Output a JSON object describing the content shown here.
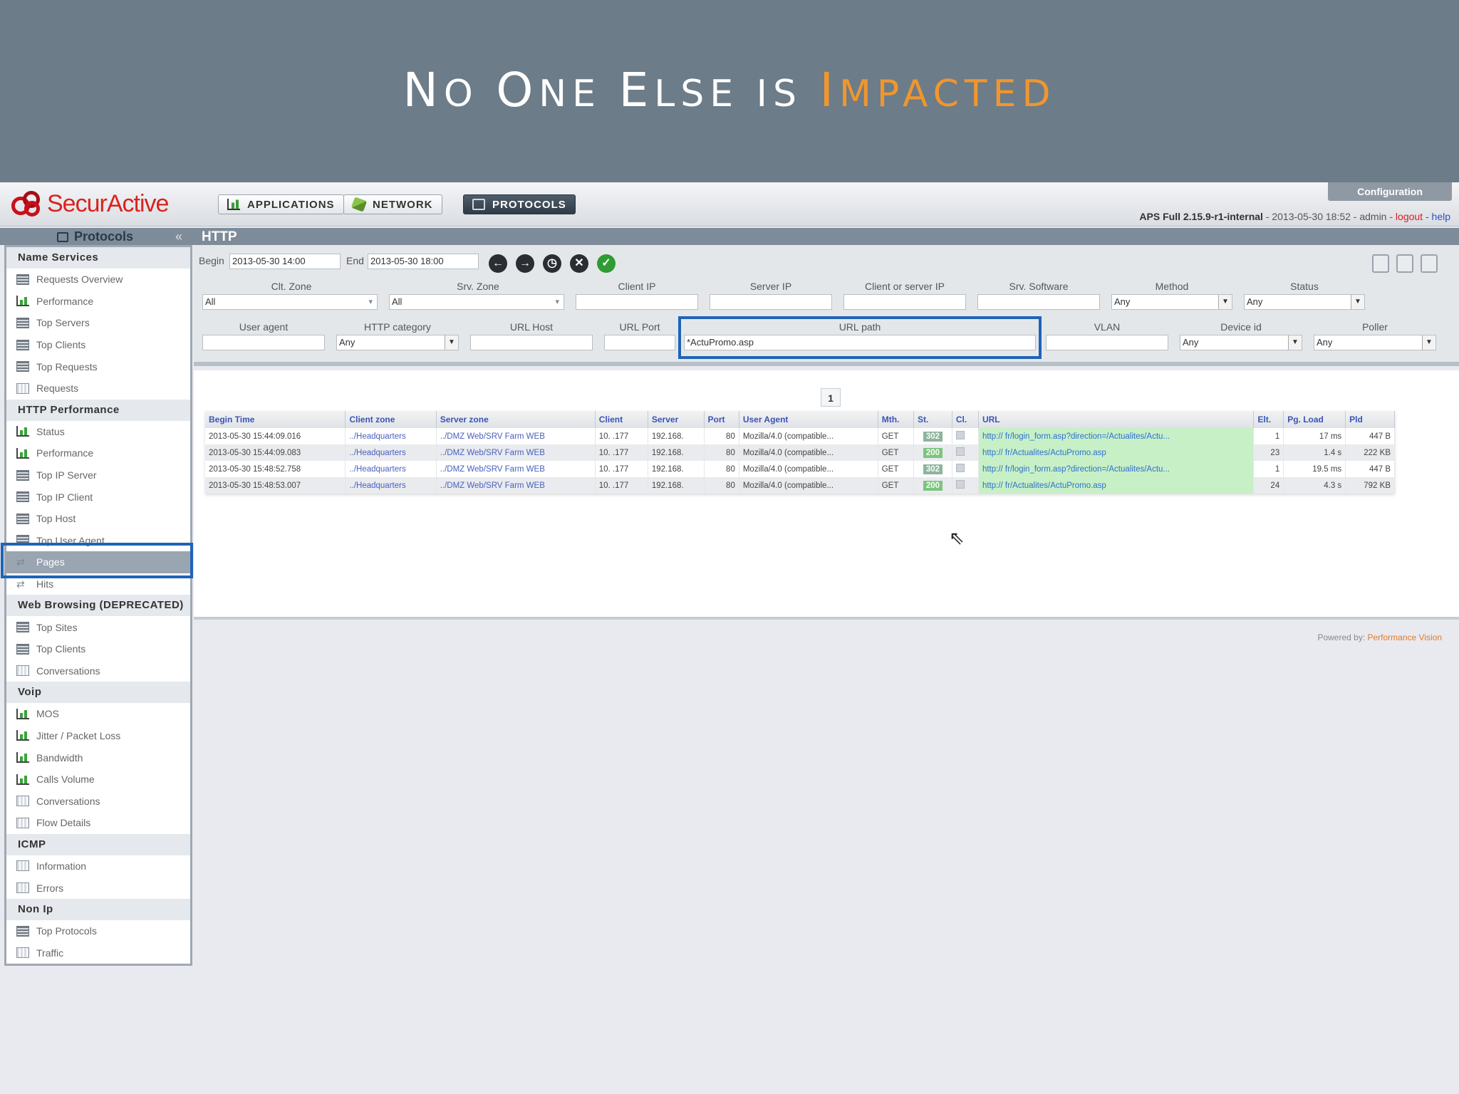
{
  "slide": {
    "title_part1_initial": "N",
    "title_part1_rest": "O ",
    "title_part2_initial": "O",
    "title_part2_rest": "NE ",
    "title_part3_initial": "E",
    "title_part3_rest": "LSE ",
    "title_part4": "IS ",
    "title_hl_initial": "I",
    "title_hl_rest": "MPACTED",
    "title_accent_color": "#f0962e"
  },
  "app": {
    "brand": "SecurActive",
    "tabs": [
      {
        "label": "APPLICATIONS",
        "icon": "chart-icon"
      },
      {
        "label": "NETWORK",
        "icon": "network-icon"
      },
      {
        "label": "PROTOCOLS",
        "icon": "protocols-icon"
      }
    ],
    "config_label": "Configuration",
    "version": "APS Full 2.15.9-r1-internal",
    "version_rest": " - 2013-05-30 18:52 - admin - ",
    "logout": "logout",
    "sep": " - ",
    "help": "help"
  },
  "sidebar": {
    "title": "Protocols",
    "sections": [
      {
        "title": "Name Services",
        "items": [
          {
            "label": "Requests Overview",
            "icon": "grid"
          },
          {
            "label": "Performance",
            "icon": "chart"
          },
          {
            "label": "Top Servers",
            "icon": "grid"
          },
          {
            "label": "Top Clients",
            "icon": "grid"
          },
          {
            "label": "Top Requests",
            "icon": "grid"
          },
          {
            "label": "Requests",
            "icon": "table"
          }
        ]
      },
      {
        "title": "HTTP Performance",
        "items": [
          {
            "label": "Status",
            "icon": "chart"
          },
          {
            "label": "Performance",
            "icon": "chart"
          },
          {
            "label": "Top IP Server",
            "icon": "grid"
          },
          {
            "label": "Top IP Client",
            "icon": "grid"
          },
          {
            "label": "Top Host",
            "icon": "grid"
          },
          {
            "label": "Top User Agent",
            "icon": "grid"
          },
          {
            "label": "Pages",
            "icon": "arrows",
            "active": true
          },
          {
            "label": "Hits",
            "icon": "arrows"
          }
        ]
      },
      {
        "title": "Web Browsing (DEPRECATED)",
        "items": [
          {
            "label": "Top Sites",
            "icon": "grid"
          },
          {
            "label": "Top Clients",
            "icon": "grid"
          },
          {
            "label": "Conversations",
            "icon": "table"
          }
        ]
      },
      {
        "title": "Voip",
        "items": [
          {
            "label": "MOS",
            "icon": "chart"
          },
          {
            "label": "Jitter / Packet Loss",
            "icon": "chart"
          },
          {
            "label": "Bandwidth",
            "icon": "chart"
          },
          {
            "label": "Calls Volume",
            "icon": "chart"
          },
          {
            "label": "Conversations",
            "icon": "table"
          },
          {
            "label": "Flow Details",
            "icon": "table"
          }
        ]
      },
      {
        "title": "ICMP",
        "items": [
          {
            "label": "Information",
            "icon": "table"
          },
          {
            "label": "Errors",
            "icon": "table"
          }
        ]
      },
      {
        "title": "Non Ip",
        "items": [
          {
            "label": "Top Protocols",
            "icon": "grid"
          },
          {
            "label": "Traffic",
            "icon": "table"
          }
        ]
      }
    ]
  },
  "page": {
    "header": "HTTP",
    "begin_label": "Begin",
    "begin_value": "2013-05-30 14:00",
    "end_label": "End",
    "end_value": "2013-05-30 18:00",
    "filters_row1": {
      "clt_zone": {
        "label": "Clt. Zone",
        "value": "All"
      },
      "srv_zone": {
        "label": "Srv. Zone",
        "value": "All"
      },
      "client_ip": {
        "label": "Client IP",
        "value": ""
      },
      "server_ip": {
        "label": "Server IP",
        "value": ""
      },
      "client_or_server_ip": {
        "label": "Client or server IP",
        "value": ""
      },
      "srv_software": {
        "label": "Srv. Software",
        "value": ""
      },
      "method": {
        "label": "Method",
        "value": "Any"
      },
      "status": {
        "label": "Status",
        "value": "Any"
      }
    },
    "filters_row2": {
      "user_agent": {
        "label": "User agent",
        "value": ""
      },
      "http_category": {
        "label": "HTTP category",
        "value": "Any"
      },
      "url_host": {
        "label": "URL Host",
        "value": ""
      },
      "url_port": {
        "label": "URL Port",
        "value": ""
      },
      "url_path": {
        "label": "URL path",
        "value": "*ActuPromo.asp"
      },
      "vlan": {
        "label": "VLAN",
        "value": ""
      },
      "device_id": {
        "label": "Device id",
        "value": "Any"
      },
      "poller": {
        "label": "Poller",
        "value": "Any"
      }
    },
    "pagination": "1",
    "table": {
      "headers": [
        "Begin Time",
        "Client zone",
        "Server zone",
        "Client",
        "Server",
        "Port",
        "User Agent",
        "Mth.",
        "St.",
        "Cl.",
        "URL",
        "Elt.",
        "Pg. Load",
        "Pld"
      ],
      "rows": [
        [
          "2013-05-30 15:44:09.016",
          "../Headquarters",
          "../DMZ Web/SRV Farm WEB",
          "10.     .177",
          "192.168.",
          "80",
          "Mozilla/4.0 (compatible...",
          "GET",
          "302",
          "",
          "http://          fr/login_form.asp?direction=/Actualites/Actu...",
          "1",
          "17 ms",
          "447 B"
        ],
        [
          "2013-05-30 15:44:09.083",
          "../Headquarters",
          "../DMZ Web/SRV Farm WEB",
          "10.     .177",
          "192.168.",
          "80",
          "Mozilla/4.0 (compatible...",
          "GET",
          "200",
          "",
          "http://          fr/Actualites/ActuPromo.asp",
          "23",
          "1.4 s",
          "222 KB"
        ],
        [
          "2013-05-30 15:48:52.758",
          "../Headquarters",
          "../DMZ Web/SRV Farm WEB",
          "10.     .177",
          "192.168.",
          "80",
          "Mozilla/4.0 (compatible...",
          "GET",
          "302",
          "",
          "http://          fr/login_form.asp?direction=/Actualites/Actu...",
          "1",
          "19.5 ms",
          "447 B"
        ],
        [
          "2013-05-30 15:48:53.007",
          "../Headquarters",
          "../DMZ Web/SRV Farm WEB",
          "10.     .177",
          "192.168.",
          "80",
          "Mozilla/4.0 (compatible...",
          "GET",
          "200",
          "",
          "http://          fr/Actualites/ActuPromo.asp",
          "24",
          "4.3 s",
          "792 KB"
        ]
      ]
    },
    "footer_prefix": "Powered by: ",
    "footer_brand": "Performance Vision"
  }
}
